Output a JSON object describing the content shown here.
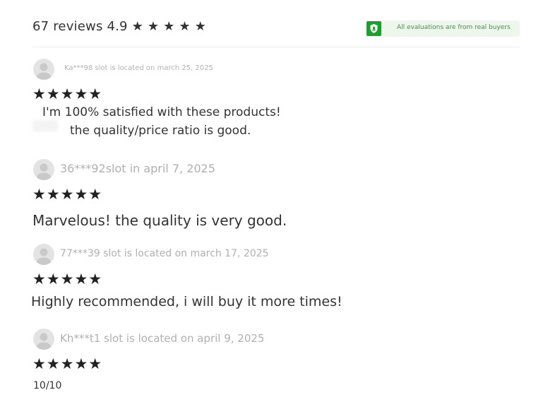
{
  "summary": {
    "text": "67 reviews 4.9 ★ ★ ★ ★ ★"
  },
  "badge": {
    "text": "All evaluations are from real buyers",
    "color": "#1e9e2f"
  },
  "reviews": [
    {
      "meta": "Ka***98 slot is located on march 25, 2025",
      "stars": "★★★★★",
      "lines": [
        "I'm 100% satisfied with these products!",
        "the quality/price ratio is good."
      ]
    },
    {
      "meta": "36***92slot in april 7, 2025",
      "stars": "★★★★★",
      "lines": [
        "Marvelous! the quality is very good."
      ]
    },
    {
      "meta": "77***39 slot is located on march 17, 2025",
      "stars": "★★★★★",
      "lines": [
        "Highly recommended, i will buy it more times!"
      ]
    },
    {
      "meta": "Kh***t1 slot is located on april 9, 2025",
      "stars": "★★★★★",
      "lines": [
        "10/10"
      ]
    }
  ]
}
